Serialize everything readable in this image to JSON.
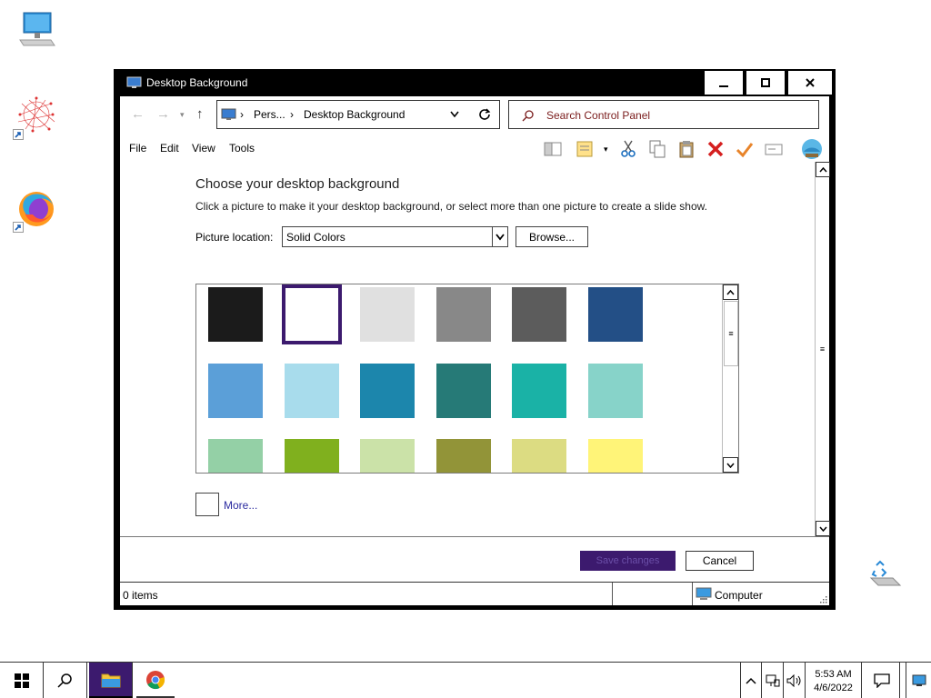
{
  "window": {
    "title": "Desktop Background",
    "min_label": "▁",
    "max_label": "☐",
    "close_label": "✕"
  },
  "nav": {
    "breadcrumb_parent": "Pers...",
    "breadcrumb_current": "Desktop Background",
    "search_placeholder": "Search Control Panel"
  },
  "menu": {
    "file": "File",
    "edit": "Edit",
    "view": "View",
    "tools": "Tools"
  },
  "page": {
    "heading": "Choose your desktop background",
    "subtitle": "Click a picture to make it your desktop background, or select more than one picture to create a slide show.",
    "picture_location_label": "Picture location:",
    "picture_location_value": "Solid Colors",
    "browse_label": "Browse...",
    "more_label": "More...",
    "save_label": "Save changes",
    "cancel_label": "Cancel"
  },
  "swatches": [
    {
      "color": "#1b1b1b",
      "selected": false
    },
    {
      "color": "#ffffff",
      "selected": true
    },
    {
      "color": "#e0e0e0",
      "selected": false
    },
    {
      "color": "#888888",
      "selected": false
    },
    {
      "color": "#5c5c5c",
      "selected": false
    },
    {
      "color": "#234f86",
      "selected": false
    },
    {
      "color": "#5b9fd8",
      "selected": false
    },
    {
      "color": "#a8dcec",
      "selected": false
    },
    {
      "color": "#1c86ac",
      "selected": false
    },
    {
      "color": "#267a77",
      "selected": false
    },
    {
      "color": "#1ab2a6",
      "selected": false
    },
    {
      "color": "#87d3c9",
      "selected": false
    },
    {
      "color": "#94d0a6",
      "selected": false
    },
    {
      "color": "#80b01e",
      "selected": false
    },
    {
      "color": "#cbe2a8",
      "selected": false
    },
    {
      "color": "#929438",
      "selected": false
    },
    {
      "color": "#dcdc82",
      "selected": false
    },
    {
      "color": "#fff478",
      "selected": false
    }
  ],
  "status": {
    "items": "0 items",
    "location": "Computer"
  },
  "tray": {
    "time": "5:53 AM",
    "date": "4/6/2022"
  },
  "colors": {
    "accent": "#3c1a6e",
    "link": "#2c2ca0"
  }
}
